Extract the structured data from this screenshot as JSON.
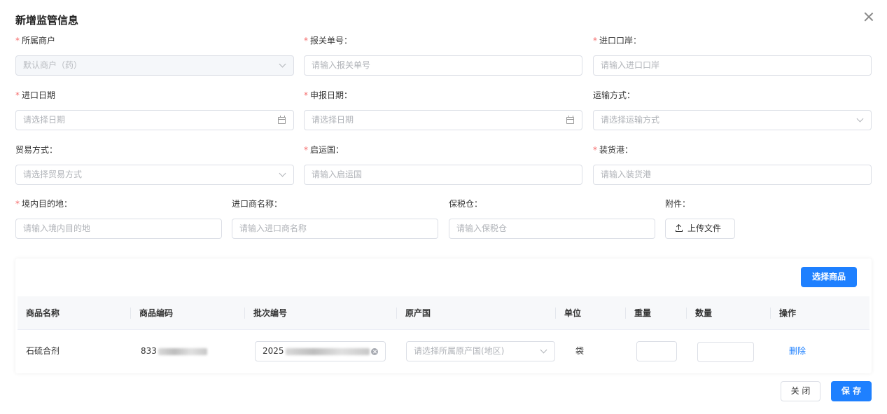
{
  "dialog": {
    "title": "新增监管信息"
  },
  "form": {
    "merchant": {
      "label": "所属商户",
      "value": "默认商户（药）"
    },
    "customs_no": {
      "label": "报关单号：",
      "placeholder": "请输入报关单号"
    },
    "import_port": {
      "label": "进口口岸：",
      "placeholder": "请输入进口口岸"
    },
    "import_date": {
      "label": "进口日期",
      "placeholder": "请选择日期"
    },
    "declare_date": {
      "label": "申报日期：",
      "placeholder": "请选择日期"
    },
    "transport": {
      "label": "运输方式：",
      "placeholder": "请选择运输方式"
    },
    "trade": {
      "label": "贸易方式：",
      "placeholder": "请选择贸易方式"
    },
    "origin_country": {
      "label": "启运国：",
      "placeholder": "请输入启运国"
    },
    "loading_port": {
      "label": "装货港：",
      "placeholder": "请输入装货港"
    },
    "destination": {
      "label": "境内目的地：",
      "placeholder": "请输入境内目的地"
    },
    "importer": {
      "label": "进口商名称：",
      "placeholder": "请输入进口商名称"
    },
    "bonded": {
      "label": "保税仓：",
      "placeholder": "请输入保税仓"
    },
    "attachment": {
      "label": "附件：",
      "button": "上传文件"
    },
    "required_mark": "*"
  },
  "goods": {
    "select_button": "选择商品",
    "columns": [
      "商品名称",
      "商品编码",
      "批次编号",
      "原产国",
      "单位",
      "重量",
      "数量",
      "操作"
    ],
    "rows": [
      {
        "name": "石硫合剂",
        "code_prefix": "833",
        "batch_prefix": "2025",
        "origin_placeholder": "请选择所属原产国(地区)",
        "unit": "袋",
        "weight": "",
        "quantity": "",
        "action": "删除"
      }
    ]
  },
  "footer": {
    "close": "关 闭",
    "save": "保 存"
  },
  "colors": {
    "primary": "#1e80ff",
    "required": "#f56c6c",
    "border": "#dcdfe6"
  }
}
